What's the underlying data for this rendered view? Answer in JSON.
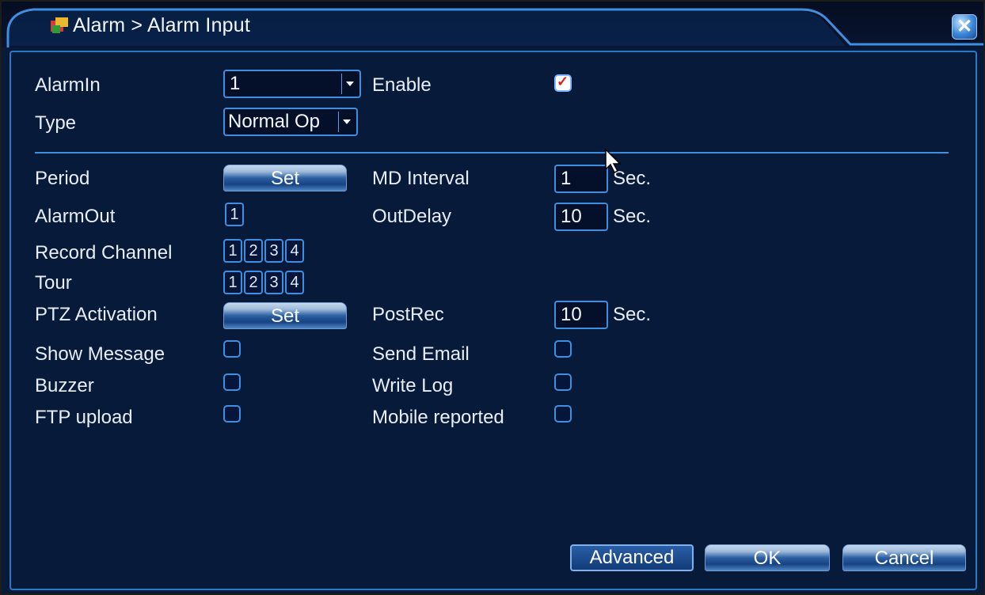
{
  "window": {
    "title": "Alarm > Alarm Input",
    "close_glyph": "✕"
  },
  "alarm_in": {
    "label": "AlarmIn",
    "value": "1"
  },
  "enable": {
    "label": "Enable",
    "checked": true,
    "check_glyph": "✓"
  },
  "type": {
    "label": "Type",
    "value": "Normal Op"
  },
  "period": {
    "label": "Period",
    "button": "Set"
  },
  "md_interval": {
    "label": "MD Interval",
    "value": "1",
    "unit": "Sec."
  },
  "alarm_out": {
    "label": "AlarmOut",
    "channels": [
      "1"
    ]
  },
  "out_delay": {
    "label": "OutDelay",
    "value": "10",
    "unit": "Sec."
  },
  "record_channel": {
    "label": "Record Channel",
    "channels": [
      "1",
      "2",
      "3",
      "4"
    ]
  },
  "tour": {
    "label": "Tour",
    "channels": [
      "1",
      "2",
      "3",
      "4"
    ]
  },
  "ptz_activation": {
    "label": "PTZ Activation",
    "button": "Set"
  },
  "post_rec": {
    "label": "PostRec",
    "value": "10",
    "unit": "Sec."
  },
  "show_message": {
    "label": "Show Message",
    "checked": false
  },
  "send_email": {
    "label": "Send Email",
    "checked": false
  },
  "buzzer": {
    "label": "Buzzer",
    "checked": false
  },
  "write_log": {
    "label": "Write Log",
    "checked": false
  },
  "ftp_upload": {
    "label": "FTP upload",
    "checked": false
  },
  "mobile_reported": {
    "label": "Mobile reported",
    "checked": false
  },
  "footer": {
    "advanced": "Advanced",
    "ok": "OK",
    "cancel": "Cancel"
  },
  "colors": {
    "background": "#081a3a",
    "border_accent": "#3f8fe0",
    "check_mark": "#e02020"
  }
}
